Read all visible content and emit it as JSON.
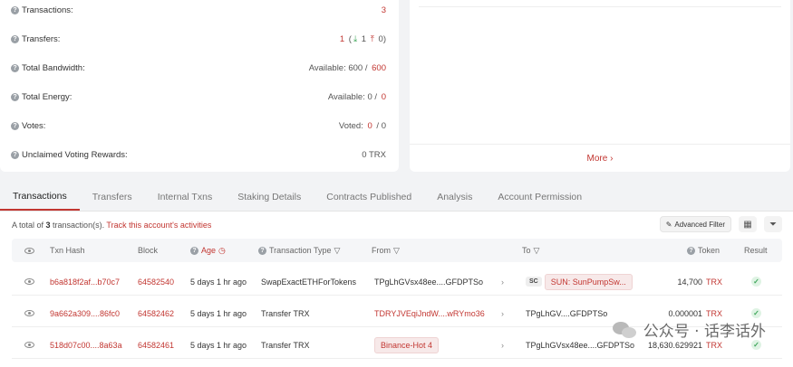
{
  "stats": [
    {
      "label": "Transactions:",
      "value_parts": [
        {
          "text": "3",
          "cls": "red"
        }
      ]
    },
    {
      "label": "Transfers:",
      "value_parts": [
        {
          "text": "1",
          "cls": "red"
        },
        {
          "text": " (",
          "cls": "grey"
        },
        {
          "text": "⤓",
          "cls": "green"
        },
        {
          "text": " 1 ",
          "cls": "grey"
        },
        {
          "text": "⤒",
          "cls": "red"
        },
        {
          "text": " 0)",
          "cls": "grey"
        }
      ]
    },
    {
      "label": "Total Bandwidth:",
      "value_parts": [
        {
          "text": "Available: 600 / ",
          "cls": "grey"
        },
        {
          "text": "600",
          "cls": "red"
        }
      ]
    },
    {
      "label": "Total Energy:",
      "value_parts": [
        {
          "text": "Available: 0 / ",
          "cls": "grey"
        },
        {
          "text": "0",
          "cls": "red"
        }
      ]
    },
    {
      "label": "Votes:",
      "value_parts": [
        {
          "text": "Voted: ",
          "cls": "grey"
        },
        {
          "text": "0",
          "cls": "red"
        },
        {
          "text": " / 0",
          "cls": "grey"
        }
      ]
    },
    {
      "label": "Unclaimed Voting Rewards:",
      "value_parts": [
        {
          "text": "0 TRX",
          "cls": "grey"
        }
      ]
    }
  ],
  "more_label": "More",
  "tabs": [
    "Transactions",
    "Transfers",
    "Internal Txns",
    "Staking Details",
    "Contracts Published",
    "Analysis",
    "Account Permission"
  ],
  "summary": {
    "prefix": "A total of ",
    "count": "3",
    "suffix": " transaction(s). ",
    "link": "Track this account's activities"
  },
  "tools": {
    "advanced_filter": "Advanced Filter"
  },
  "columns": {
    "txn_hash": "Txn Hash",
    "block": "Block",
    "age": "Age",
    "type": "Transaction Type",
    "from": "From",
    "to": "To",
    "token": "Token",
    "result": "Result"
  },
  "rows": [
    {
      "hash": "b6a818f2af...b70c7",
      "block": "64582540",
      "age": "5 days 1 hr ago",
      "type": "SwapExactETHForTokens",
      "from": "TPgLhGVsx48ee....GFDPTSo",
      "from_tag": false,
      "to_sc": "SC",
      "to": "SUN: SunPumpSw...",
      "to_tag": true,
      "amount": "14,700",
      "unit": "TRX"
    },
    {
      "hash": "9a662a309....86fc0",
      "block": "64582462",
      "age": "5 days 1 hr ago",
      "type": "Transfer TRX",
      "from": "TDRYJVEqiJndW....wRYmo36",
      "from_tag": false,
      "from_red": true,
      "to_sc": "",
      "to": "TPgLhGV....GFDPTSo",
      "to_tag": false,
      "amount": "0.000001",
      "unit": "TRX"
    },
    {
      "hash": "518d07c00....8a63a",
      "block": "64582461",
      "age": "5 days 1 hr ago",
      "type": "Transfer TRX",
      "from": "Binance-Hot 4",
      "from_tag": true,
      "to_sc": "",
      "to": "TPgLhGVsx48ee....GFDPTSo",
      "to_tag": false,
      "amount": "18,630.629921",
      "unit": "TRX"
    }
  ],
  "watermark": "公众号 · 话李话外",
  "colors": {
    "accent": "#c23631",
    "success": "#3fa65a"
  }
}
